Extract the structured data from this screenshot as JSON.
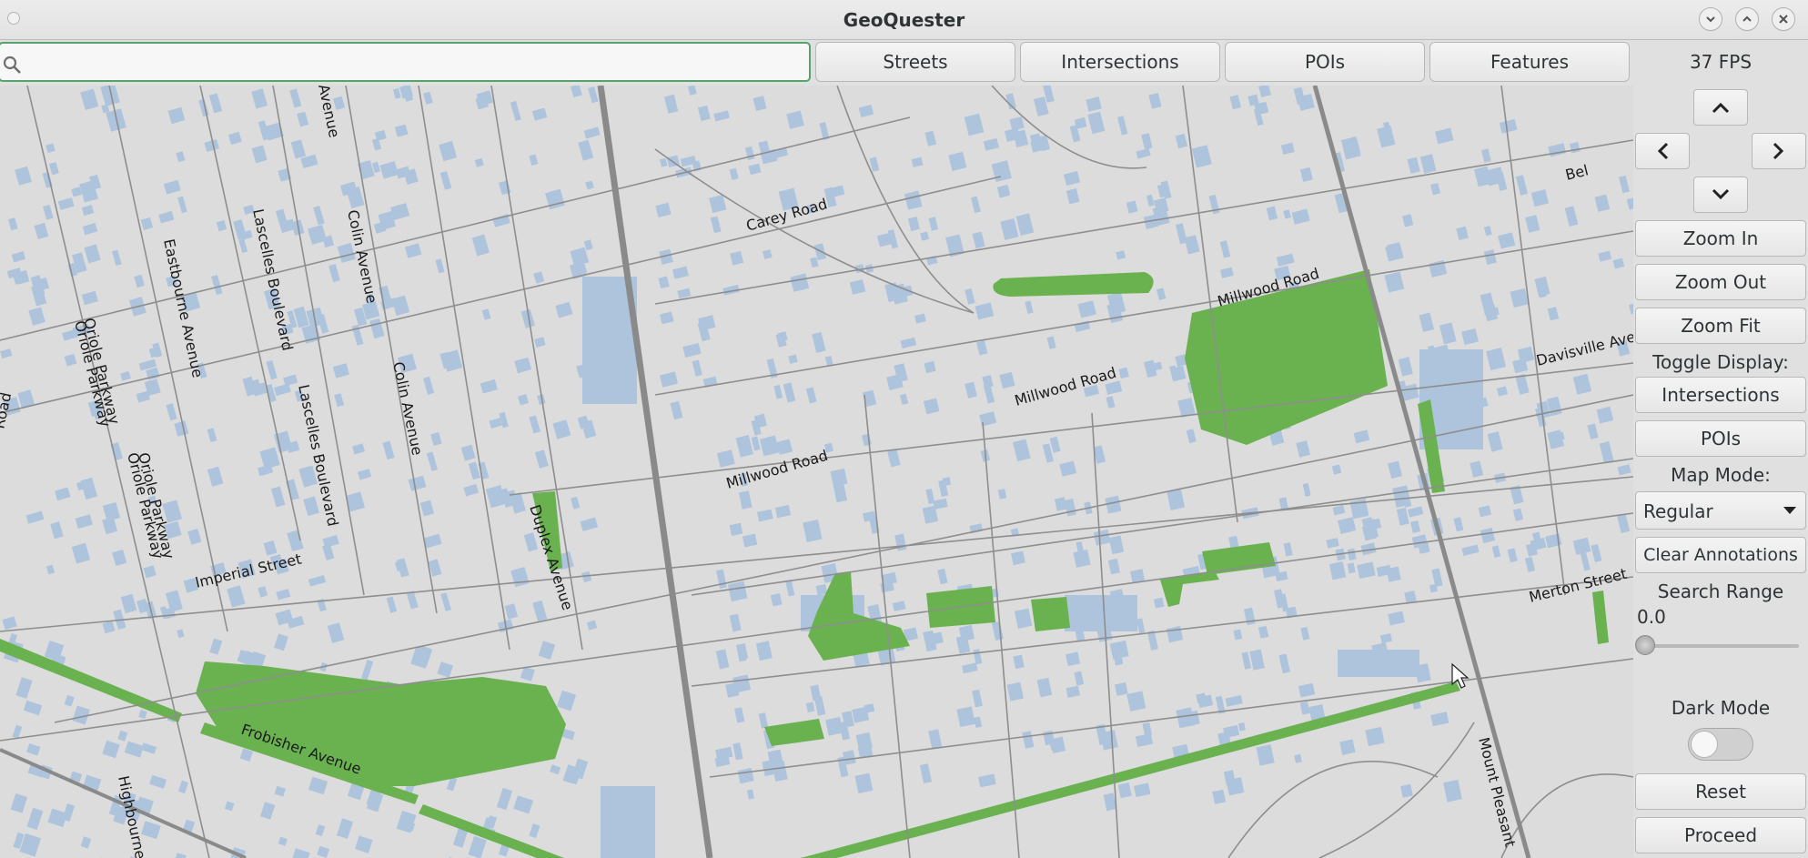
{
  "window": {
    "title": "GeoQuester"
  },
  "search": {
    "value": "",
    "placeholder": ""
  },
  "toolbar": {
    "streets": "Streets",
    "intersections": "Intersections",
    "pois": "POIs",
    "features": "Features"
  },
  "panel": {
    "fps": "37 FPS",
    "zoom_in": "Zoom In",
    "zoom_out": "Zoom Out",
    "zoom_fit": "Zoom Fit",
    "toggle_display": "Toggle Display:",
    "intersections": "Intersections",
    "pois": "POIs",
    "map_mode_label": "Map Mode:",
    "map_mode_value": "Regular",
    "clear_annotations": "Clear Annotations",
    "search_range_label": "Search Range",
    "search_range_value": "0.0",
    "dark_mode_label": "Dark Mode",
    "reset": "Reset",
    "proceed": "Proceed"
  },
  "colors": {
    "park": "#6ab150",
    "building": "#aec3dc",
    "map_bg": "#dcdcdc",
    "road": "#8a8a8a",
    "focus": "#55a46e"
  },
  "map": {
    "street_labels": [
      "Carey Road",
      "Millwood Road",
      "Millwood Road",
      "Millwood Road",
      "Davisville Ave",
      "Merton Street",
      "Mount Pleasant",
      "Imperial Street",
      "Frobisher Avenue",
      "Duplex Avenue",
      "Colin Avenue",
      "Colin Avenue",
      "Lascelles Boulevard",
      "Lascelles Boulevard",
      "Eastbourne Avenue",
      "Oriole Parkway",
      "Oriole Parkway",
      "Oriole Parkway",
      "Oriole Parkway",
      "Avenue",
      "Highbourne",
      "Road",
      "Bel"
    ]
  }
}
